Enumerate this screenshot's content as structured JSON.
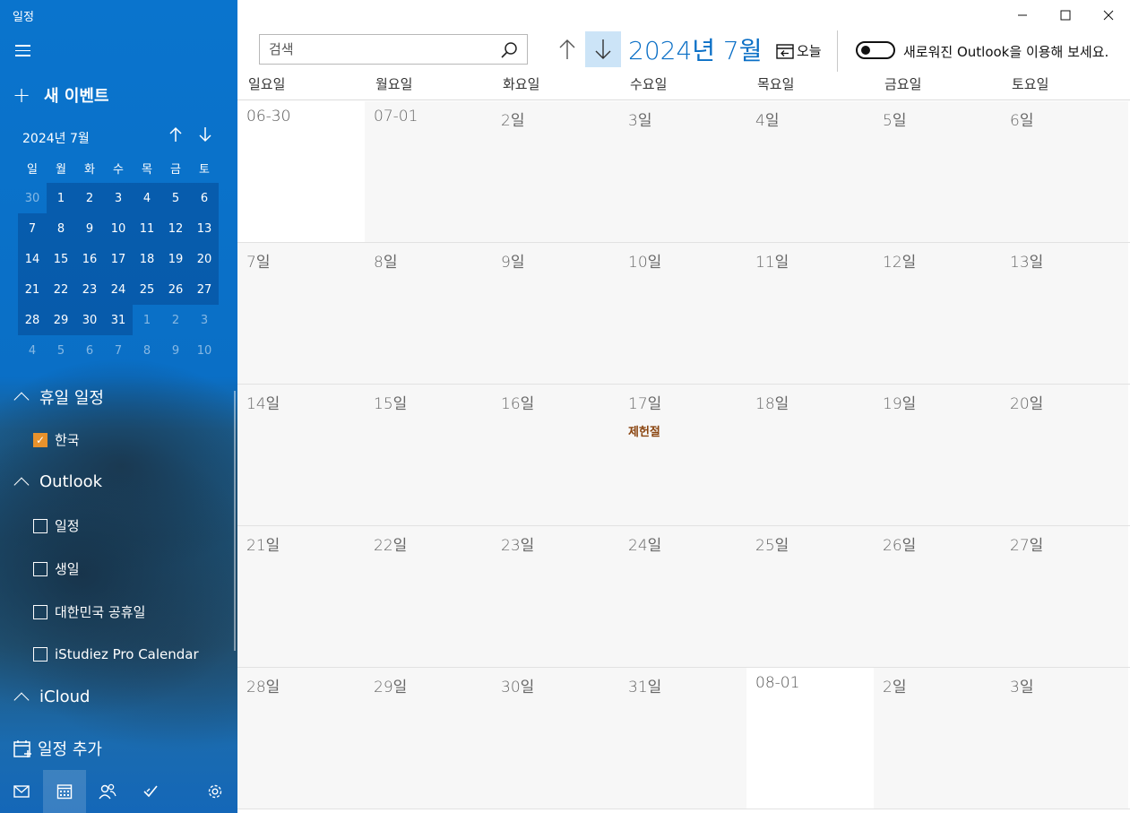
{
  "app": {
    "title": "일정"
  },
  "sidebar": {
    "new_event_label": "새 이벤트",
    "mini_calendar": {
      "month_label": "2024년 7월",
      "weekdays": [
        "일",
        "월",
        "화",
        "수",
        "목",
        "금",
        "토"
      ],
      "weeks": [
        [
          "30",
          "1",
          "2",
          "3",
          "4",
          "5",
          "6"
        ],
        [
          "7",
          "8",
          "9",
          "10",
          "11",
          "12",
          "13"
        ],
        [
          "14",
          "15",
          "16",
          "17",
          "18",
          "19",
          "20"
        ],
        [
          "21",
          "22",
          "23",
          "24",
          "25",
          "26",
          "27"
        ],
        [
          "28",
          "29",
          "30",
          "31",
          "1",
          "2",
          "3"
        ],
        [
          "4",
          "5",
          "6",
          "7",
          "8",
          "9",
          "10"
        ]
      ]
    },
    "sections": {
      "holiday": {
        "label": "휴일 일정",
        "items": [
          {
            "label": "한국",
            "checked": true
          }
        ]
      },
      "outlook": {
        "label": "Outlook",
        "items": [
          {
            "label": "일정",
            "checked": false
          },
          {
            "label": "생일",
            "checked": false
          },
          {
            "label": "대한민국 공휴일",
            "checked": false
          },
          {
            "label": "iStudiez Pro Calendar",
            "checked": false
          }
        ]
      },
      "icloud": {
        "label": "iCloud"
      }
    },
    "add_calendar_label": "일정 추가",
    "bottom_icons": [
      "mail-icon",
      "calendar-icon",
      "people-icon",
      "todo-icon",
      "settings-icon"
    ]
  },
  "toolbar": {
    "search_placeholder": "검색",
    "month_title": "2024년 7월",
    "today_label": "오늘",
    "new_outlook_label": "새로워진 Outlook을 이용해 보세요.",
    "new_outlook_toggle": false
  },
  "calendar": {
    "weekday_headers": [
      "일요일",
      "월요일",
      "화요일",
      "수요일",
      "목요일",
      "금요일",
      "토요일"
    ],
    "weeks": [
      [
        {
          "label": "06-30"
        },
        {
          "label": "07-01"
        },
        {
          "label": "2일"
        },
        {
          "label": "3일"
        },
        {
          "label": "4일"
        },
        {
          "label": "5일"
        },
        {
          "label": "6일"
        }
      ],
      [
        {
          "label": "7일"
        },
        {
          "label": "8일"
        },
        {
          "label": "9일"
        },
        {
          "label": "10일"
        },
        {
          "label": "11일"
        },
        {
          "label": "12일"
        },
        {
          "label": "13일"
        }
      ],
      [
        {
          "label": "14일"
        },
        {
          "label": "15일"
        },
        {
          "label": "16일"
        },
        {
          "label": "17일",
          "event": "제헌절"
        },
        {
          "label": "18일"
        },
        {
          "label": "19일"
        },
        {
          "label": "20일"
        }
      ],
      [
        {
          "label": "21일"
        },
        {
          "label": "22일"
        },
        {
          "label": "23일"
        },
        {
          "label": "24일"
        },
        {
          "label": "25일"
        },
        {
          "label": "26일"
        },
        {
          "label": "27일"
        }
      ],
      [
        {
          "label": "28일"
        },
        {
          "label": "29일"
        },
        {
          "label": "30일"
        },
        {
          "label": "31일"
        },
        {
          "label": "08-01"
        },
        {
          "label": "2일"
        },
        {
          "label": "3일"
        }
      ]
    ]
  },
  "colors": {
    "accent": "#0a6fc6",
    "event_text": "#8a4510",
    "checkbox_on": "#e8922c"
  }
}
